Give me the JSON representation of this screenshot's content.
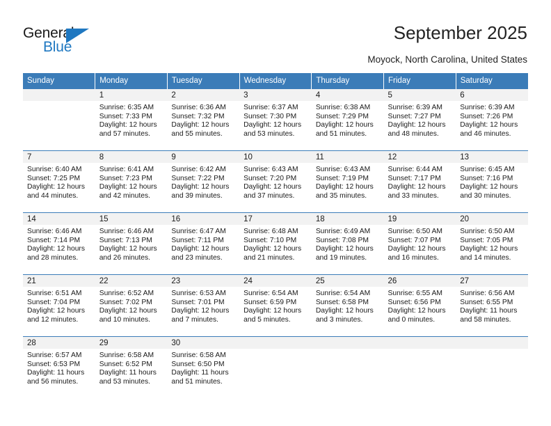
{
  "brand": {
    "name_part1": "General",
    "name_part2": "Blue",
    "accent_color": "#1f78c1",
    "triangle_icon": "triangle-icon"
  },
  "header": {
    "title": "September 2025",
    "subtitle": "Moyock, North Carolina, United States"
  },
  "calendar": {
    "header_bg": "#3b7cb8",
    "daynum_bg": "#f2f2f2",
    "weekday_headers": [
      "Sunday",
      "Monday",
      "Tuesday",
      "Wednesday",
      "Thursday",
      "Friday",
      "Saturday"
    ],
    "labels": {
      "sunrise": "Sunrise:",
      "sunset": "Sunset:",
      "daylight": "Daylight:"
    },
    "weeks": [
      [
        {
          "day": "",
          "sunrise": "",
          "sunset": "",
          "daylight_line1": "",
          "daylight_line2": ""
        },
        {
          "day": "1",
          "sunrise": "Sunrise: 6:35 AM",
          "sunset": "Sunset: 7:33 PM",
          "daylight_line1": "Daylight: 12 hours",
          "daylight_line2": "and 57 minutes."
        },
        {
          "day": "2",
          "sunrise": "Sunrise: 6:36 AM",
          "sunset": "Sunset: 7:32 PM",
          "daylight_line1": "Daylight: 12 hours",
          "daylight_line2": "and 55 minutes."
        },
        {
          "day": "3",
          "sunrise": "Sunrise: 6:37 AM",
          "sunset": "Sunset: 7:30 PM",
          "daylight_line1": "Daylight: 12 hours",
          "daylight_line2": "and 53 minutes."
        },
        {
          "day": "4",
          "sunrise": "Sunrise: 6:38 AM",
          "sunset": "Sunset: 7:29 PM",
          "daylight_line1": "Daylight: 12 hours",
          "daylight_line2": "and 51 minutes."
        },
        {
          "day": "5",
          "sunrise": "Sunrise: 6:39 AM",
          "sunset": "Sunset: 7:27 PM",
          "daylight_line1": "Daylight: 12 hours",
          "daylight_line2": "and 48 minutes."
        },
        {
          "day": "6",
          "sunrise": "Sunrise: 6:39 AM",
          "sunset": "Sunset: 7:26 PM",
          "daylight_line1": "Daylight: 12 hours",
          "daylight_line2": "and 46 minutes."
        }
      ],
      [
        {
          "day": "7",
          "sunrise": "Sunrise: 6:40 AM",
          "sunset": "Sunset: 7:25 PM",
          "daylight_line1": "Daylight: 12 hours",
          "daylight_line2": "and 44 minutes."
        },
        {
          "day": "8",
          "sunrise": "Sunrise: 6:41 AM",
          "sunset": "Sunset: 7:23 PM",
          "daylight_line1": "Daylight: 12 hours",
          "daylight_line2": "and 42 minutes."
        },
        {
          "day": "9",
          "sunrise": "Sunrise: 6:42 AM",
          "sunset": "Sunset: 7:22 PM",
          "daylight_line1": "Daylight: 12 hours",
          "daylight_line2": "and 39 minutes."
        },
        {
          "day": "10",
          "sunrise": "Sunrise: 6:43 AM",
          "sunset": "Sunset: 7:20 PM",
          "daylight_line1": "Daylight: 12 hours",
          "daylight_line2": "and 37 minutes."
        },
        {
          "day": "11",
          "sunrise": "Sunrise: 6:43 AM",
          "sunset": "Sunset: 7:19 PM",
          "daylight_line1": "Daylight: 12 hours",
          "daylight_line2": "and 35 minutes."
        },
        {
          "day": "12",
          "sunrise": "Sunrise: 6:44 AM",
          "sunset": "Sunset: 7:17 PM",
          "daylight_line1": "Daylight: 12 hours",
          "daylight_line2": "and 33 minutes."
        },
        {
          "day": "13",
          "sunrise": "Sunrise: 6:45 AM",
          "sunset": "Sunset: 7:16 PM",
          "daylight_line1": "Daylight: 12 hours",
          "daylight_line2": "and 30 minutes."
        }
      ],
      [
        {
          "day": "14",
          "sunrise": "Sunrise: 6:46 AM",
          "sunset": "Sunset: 7:14 PM",
          "daylight_line1": "Daylight: 12 hours",
          "daylight_line2": "and 28 minutes."
        },
        {
          "day": "15",
          "sunrise": "Sunrise: 6:46 AM",
          "sunset": "Sunset: 7:13 PM",
          "daylight_line1": "Daylight: 12 hours",
          "daylight_line2": "and 26 minutes."
        },
        {
          "day": "16",
          "sunrise": "Sunrise: 6:47 AM",
          "sunset": "Sunset: 7:11 PM",
          "daylight_line1": "Daylight: 12 hours",
          "daylight_line2": "and 23 minutes."
        },
        {
          "day": "17",
          "sunrise": "Sunrise: 6:48 AM",
          "sunset": "Sunset: 7:10 PM",
          "daylight_line1": "Daylight: 12 hours",
          "daylight_line2": "and 21 minutes."
        },
        {
          "day": "18",
          "sunrise": "Sunrise: 6:49 AM",
          "sunset": "Sunset: 7:08 PM",
          "daylight_line1": "Daylight: 12 hours",
          "daylight_line2": "and 19 minutes."
        },
        {
          "day": "19",
          "sunrise": "Sunrise: 6:50 AM",
          "sunset": "Sunset: 7:07 PM",
          "daylight_line1": "Daylight: 12 hours",
          "daylight_line2": "and 16 minutes."
        },
        {
          "day": "20",
          "sunrise": "Sunrise: 6:50 AM",
          "sunset": "Sunset: 7:05 PM",
          "daylight_line1": "Daylight: 12 hours",
          "daylight_line2": "and 14 minutes."
        }
      ],
      [
        {
          "day": "21",
          "sunrise": "Sunrise: 6:51 AM",
          "sunset": "Sunset: 7:04 PM",
          "daylight_line1": "Daylight: 12 hours",
          "daylight_line2": "and 12 minutes."
        },
        {
          "day": "22",
          "sunrise": "Sunrise: 6:52 AM",
          "sunset": "Sunset: 7:02 PM",
          "daylight_line1": "Daylight: 12 hours",
          "daylight_line2": "and 10 minutes."
        },
        {
          "day": "23",
          "sunrise": "Sunrise: 6:53 AM",
          "sunset": "Sunset: 7:01 PM",
          "daylight_line1": "Daylight: 12 hours",
          "daylight_line2": "and 7 minutes."
        },
        {
          "day": "24",
          "sunrise": "Sunrise: 6:54 AM",
          "sunset": "Sunset: 6:59 PM",
          "daylight_line1": "Daylight: 12 hours",
          "daylight_line2": "and 5 minutes."
        },
        {
          "day": "25",
          "sunrise": "Sunrise: 6:54 AM",
          "sunset": "Sunset: 6:58 PM",
          "daylight_line1": "Daylight: 12 hours",
          "daylight_line2": "and 3 minutes."
        },
        {
          "day": "26",
          "sunrise": "Sunrise: 6:55 AM",
          "sunset": "Sunset: 6:56 PM",
          "daylight_line1": "Daylight: 12 hours",
          "daylight_line2": "and 0 minutes."
        },
        {
          "day": "27",
          "sunrise": "Sunrise: 6:56 AM",
          "sunset": "Sunset: 6:55 PM",
          "daylight_line1": "Daylight: 11 hours",
          "daylight_line2": "and 58 minutes."
        }
      ],
      [
        {
          "day": "28",
          "sunrise": "Sunrise: 6:57 AM",
          "sunset": "Sunset: 6:53 PM",
          "daylight_line1": "Daylight: 11 hours",
          "daylight_line2": "and 56 minutes."
        },
        {
          "day": "29",
          "sunrise": "Sunrise: 6:58 AM",
          "sunset": "Sunset: 6:52 PM",
          "daylight_line1": "Daylight: 11 hours",
          "daylight_line2": "and 53 minutes."
        },
        {
          "day": "30",
          "sunrise": "Sunrise: 6:58 AM",
          "sunset": "Sunset: 6:50 PM",
          "daylight_line1": "Daylight: 11 hours",
          "daylight_line2": "and 51 minutes."
        },
        {
          "day": "",
          "sunrise": "",
          "sunset": "",
          "daylight_line1": "",
          "daylight_line2": ""
        },
        {
          "day": "",
          "sunrise": "",
          "sunset": "",
          "daylight_line1": "",
          "daylight_line2": ""
        },
        {
          "day": "",
          "sunrise": "",
          "sunset": "",
          "daylight_line1": "",
          "daylight_line2": ""
        },
        {
          "day": "",
          "sunrise": "",
          "sunset": "",
          "daylight_line1": "",
          "daylight_line2": ""
        }
      ]
    ]
  }
}
